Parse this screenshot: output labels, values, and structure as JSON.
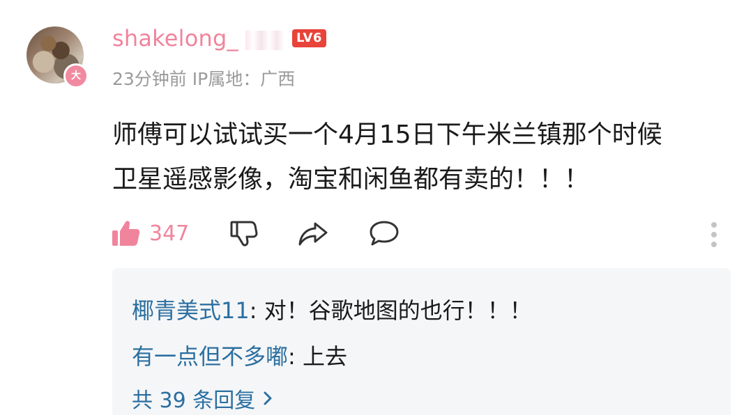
{
  "comment": {
    "username": "shakelong_",
    "level_badge": "LV6",
    "avatar_badge": "大",
    "time": "23分钟前",
    "ip_location": "IP属地：广西",
    "text_line1": "师傅可以试试买一个4月15日下午米兰镇那个时候",
    "text_line2": "卫星遥感影像，淘宝和闲鱼都有卖的！！！",
    "like_count": "347"
  },
  "actions": {
    "like_icon": "thumbs-up-icon",
    "dislike_icon": "thumbs-down-icon",
    "share_icon": "share-icon",
    "reply_icon": "chat-bubble-icon",
    "more_icon": "more-vertical-icon"
  },
  "replies": {
    "items": [
      {
        "user": "椰青美式11",
        "sep": ": ",
        "text": "对！谷歌地图的也行！！！"
      },
      {
        "user": "有一点但不多嘟",
        "sep": ": ",
        "text": "上去"
      }
    ],
    "more_label": "共 39 条回复"
  },
  "colors": {
    "username": "#f0849c",
    "like_active": "#f0849c",
    "level_badge": "#e8443a",
    "reply_user": "#2b6fa0",
    "meta": "#9a9a9a",
    "reply_panel_bg": "#f5f6f8"
  }
}
